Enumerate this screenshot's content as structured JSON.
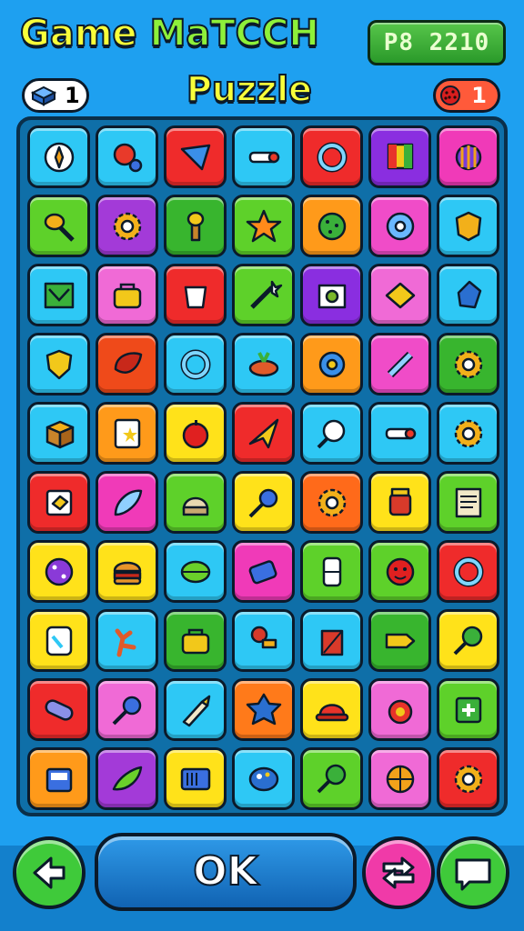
{
  "header": {
    "title_game": "Game",
    "title_match": "MaTCCH",
    "title_puzzle": "Puzzle",
    "score": "P8 2210",
    "left_counter": "1",
    "right_counter": "1",
    "left_counter_icon": "gem-icon",
    "right_counter_icon": "berry-icon"
  },
  "board": {
    "rows": [
      [
        {
          "color": "#2ec8f5",
          "icon": "compass"
        },
        {
          "color": "#2ec8f5",
          "icon": "ball"
        },
        {
          "color": "#ef2b2b",
          "icon": "cone"
        },
        {
          "color": "#2ec8f5",
          "icon": "key"
        },
        {
          "color": "#ef2b2b",
          "icon": "ring"
        },
        {
          "color": "#8a2ee0",
          "icon": "flag"
        },
        {
          "color": "#f03ab8",
          "icon": "shell"
        }
      ],
      [
        {
          "color": "#5ed12a",
          "icon": "spoon"
        },
        {
          "color": "#a33ad8",
          "icon": "gear"
        },
        {
          "color": "#38b52e",
          "icon": "torch"
        },
        {
          "color": "#5ed12a",
          "icon": "star"
        },
        {
          "color": "#ff9a1a",
          "icon": "cookie"
        },
        {
          "color": "#f04cc8",
          "icon": "disc"
        },
        {
          "color": "#2ec8f5",
          "icon": "badge"
        }
      ],
      [
        {
          "color": "#2ec8f5",
          "icon": "map"
        },
        {
          "color": "#f06ad6",
          "icon": "bag"
        },
        {
          "color": "#ef2b2b",
          "icon": "cup"
        },
        {
          "color": "#5ed12a",
          "icon": "wand"
        },
        {
          "color": "#8a2ee0",
          "icon": "frame"
        },
        {
          "color": "#f06ad6",
          "icon": "diamond"
        },
        {
          "color": "#2ec8f5",
          "icon": "blob"
        }
      ],
      [
        {
          "color": "#2ec8f5",
          "icon": "shield"
        },
        {
          "color": "#ef4a1a",
          "icon": "leaf"
        },
        {
          "color": "#2ec8f5",
          "icon": "ring"
        },
        {
          "color": "#2ec8f5",
          "icon": "fruit"
        },
        {
          "color": "#ff9a1a",
          "icon": "flower"
        },
        {
          "color": "#f04cc8",
          "icon": "bone"
        },
        {
          "color": "#38b52e",
          "icon": "gear"
        }
      ],
      [
        {
          "color": "#2ec8f5",
          "icon": "cube"
        },
        {
          "color": "#ff9a1a",
          "icon": "card"
        },
        {
          "color": "#ffe21a",
          "icon": "apple"
        },
        {
          "color": "#ef2b2b",
          "icon": "plane"
        },
        {
          "color": "#2ec8f5",
          "icon": "lollipop"
        },
        {
          "color": "#2ec8f5",
          "icon": "key"
        },
        {
          "color": "#2ec8f5",
          "icon": "gear"
        }
      ],
      [
        {
          "color": "#ef2b2b",
          "icon": "box"
        },
        {
          "color": "#f03ab8",
          "icon": "feather"
        },
        {
          "color": "#5ed12a",
          "icon": "helmet"
        },
        {
          "color": "#ffe21a",
          "icon": "pin"
        },
        {
          "color": "#ff6a1a",
          "icon": "gear"
        },
        {
          "color": "#ffe21a",
          "icon": "jar"
        },
        {
          "color": "#5ed12a",
          "icon": "note"
        }
      ],
      [
        {
          "color": "#ffe21a",
          "icon": "dice"
        },
        {
          "color": "#ffe21a",
          "icon": "burger"
        },
        {
          "color": "#2ec8f5",
          "icon": "melon"
        },
        {
          "color": "#f03ab8",
          "icon": "tag"
        },
        {
          "color": "#5ed12a",
          "icon": "domino"
        },
        {
          "color": "#5ed12a",
          "icon": "face"
        },
        {
          "color": "#ef2b2b",
          "icon": "ring"
        }
      ],
      [
        {
          "color": "#ffe21a",
          "icon": "phone"
        },
        {
          "color": "#2ec8f5",
          "icon": "coral"
        },
        {
          "color": "#38b52e",
          "icon": "bag"
        },
        {
          "color": "#2ec8f5",
          "icon": "plunger"
        },
        {
          "color": "#2ec8f5",
          "icon": "brick"
        },
        {
          "color": "#38b52e",
          "icon": "arrow"
        },
        {
          "color": "#ffe21a",
          "icon": "racket"
        }
      ],
      [
        {
          "color": "#ef2b2b",
          "icon": "capsule"
        },
        {
          "color": "#f06ad6",
          "icon": "pin"
        },
        {
          "color": "#2ec8f5",
          "icon": "pen"
        },
        {
          "color": "#ff7a1a",
          "icon": "star6"
        },
        {
          "color": "#ffe21a",
          "icon": "hat"
        },
        {
          "color": "#f06ad6",
          "icon": "bomb"
        },
        {
          "color": "#5ed12a",
          "icon": "plus"
        }
      ],
      [
        {
          "color": "#ff9a1a",
          "icon": "robot"
        },
        {
          "color": "#a33ad8",
          "icon": "pepper"
        },
        {
          "color": "#ffe21a",
          "icon": "radio"
        },
        {
          "color": "#2ec8f5",
          "icon": "palette"
        },
        {
          "color": "#5ed12a",
          "icon": "racket"
        },
        {
          "color": "#f06ad6",
          "icon": "basketball"
        },
        {
          "color": "#ef2b2b",
          "icon": "gear"
        }
      ]
    ]
  },
  "buttons": {
    "back": {
      "color": "#3fca3a",
      "icon": "arrow-left-icon"
    },
    "ok_label": "OK",
    "shuffle": {
      "color": "#f03aa8",
      "icon": "shuffle-icon"
    },
    "chat": {
      "color": "#3fca3a",
      "icon": "chat-icon"
    }
  }
}
